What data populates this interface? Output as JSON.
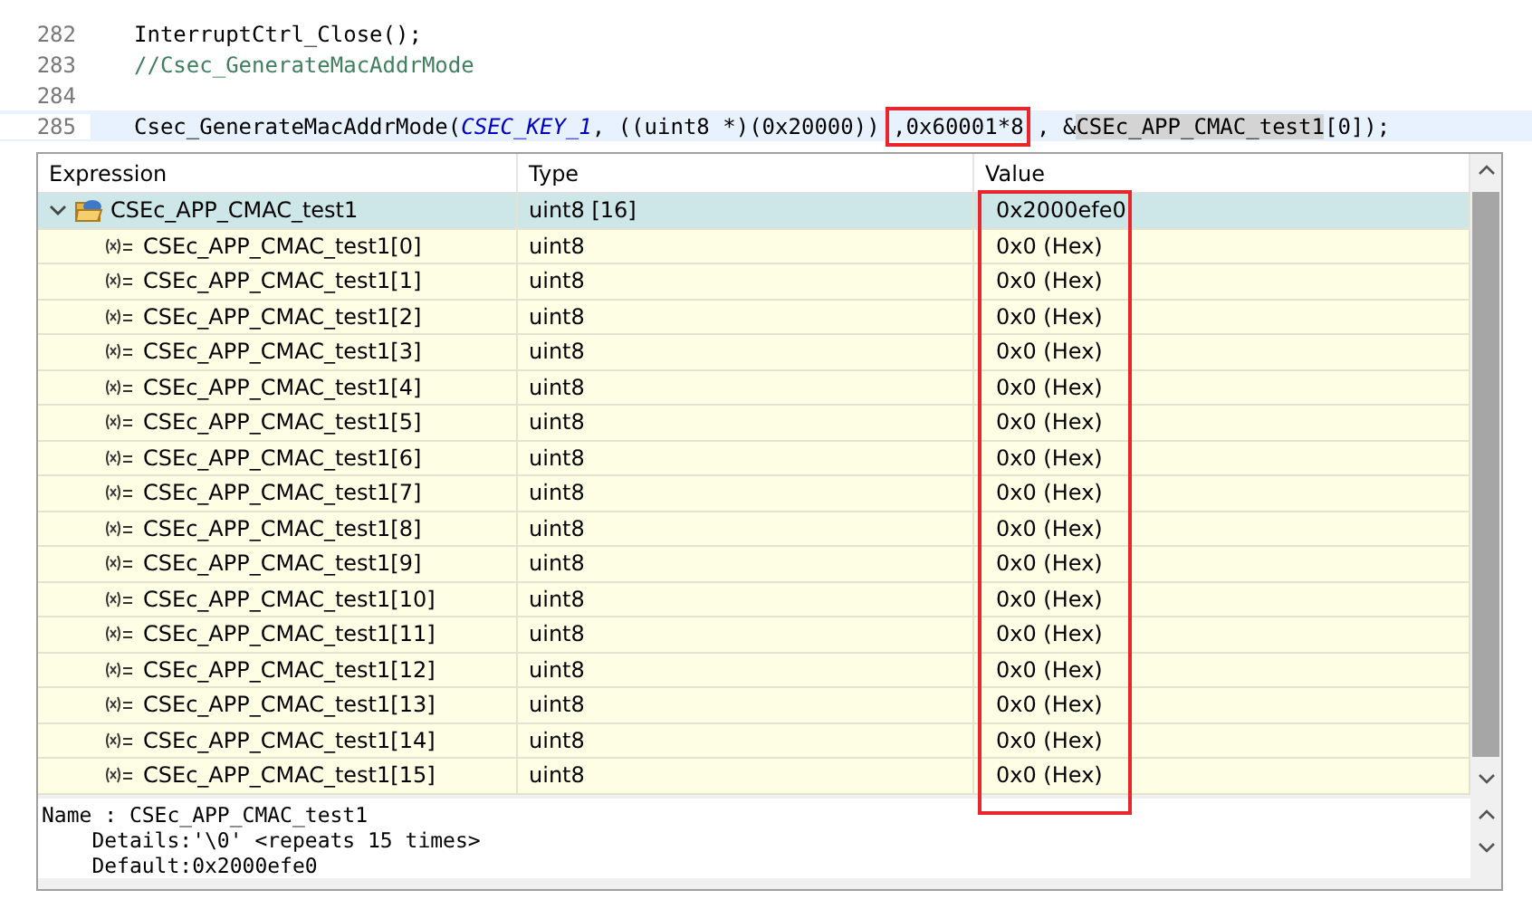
{
  "editor": {
    "lines": [
      {
        "number": "282",
        "current": false,
        "segments": [
          {
            "kind": "plain",
            "text": "InterruptCtrl_Close();"
          }
        ]
      },
      {
        "number": "283",
        "current": false,
        "segments": [
          {
            "kind": "comment",
            "text": "//Csec_GenerateMacAddrMode"
          }
        ]
      },
      {
        "number": "284",
        "current": false
      },
      {
        "number": "285",
        "current": true,
        "segments": [
          {
            "kind": "plain",
            "text": "Csec_GenerateMacAddrMode("
          },
          {
            "kind": "constant",
            "text": "CSEC_KEY_1"
          },
          {
            "kind": "plain",
            "text": ", ((uint8 *)(0x20000)) "
          },
          {
            "kind": "boxed",
            "text": ",0x60001*8"
          },
          {
            "kind": "plain",
            "text": " , &"
          },
          {
            "kind": "occurrence",
            "text": "CSEc_APP_CMAC_test1"
          },
          {
            "kind": "plain",
            "text": "[0]);"
          }
        ]
      }
    ]
  },
  "hover": {
    "columns": [
      "Expression",
      "Type",
      "Value"
    ],
    "value_column_boxed": true,
    "root": {
      "expression": "CSEc_APP_CMAC_test1",
      "type": "uint8 [16]",
      "value": "0x2000efe0",
      "expanded": true,
      "selected": true
    },
    "rows": [
      {
        "expression": "CSEc_APP_CMAC_test1[0]",
        "type": "uint8",
        "value": "0x0 (Hex)"
      },
      {
        "expression": "CSEc_APP_CMAC_test1[1]",
        "type": "uint8",
        "value": "0x0 (Hex)"
      },
      {
        "expression": "CSEc_APP_CMAC_test1[2]",
        "type": "uint8",
        "value": "0x0 (Hex)"
      },
      {
        "expression": "CSEc_APP_CMAC_test1[3]",
        "type": "uint8",
        "value": "0x0 (Hex)"
      },
      {
        "expression": "CSEc_APP_CMAC_test1[4]",
        "type": "uint8",
        "value": "0x0 (Hex)"
      },
      {
        "expression": "CSEc_APP_CMAC_test1[5]",
        "type": "uint8",
        "value": "0x0 (Hex)"
      },
      {
        "expression": "CSEc_APP_CMAC_test1[6]",
        "type": "uint8",
        "value": "0x0 (Hex)"
      },
      {
        "expression": "CSEc_APP_CMAC_test1[7]",
        "type": "uint8",
        "value": "0x0 (Hex)"
      },
      {
        "expression": "CSEc_APP_CMAC_test1[8]",
        "type": "uint8",
        "value": "0x0 (Hex)"
      },
      {
        "expression": "CSEc_APP_CMAC_test1[9]",
        "type": "uint8",
        "value": "0x0 (Hex)"
      },
      {
        "expression": "CSEc_APP_CMAC_test1[10]",
        "type": "uint8",
        "value": "0x0 (Hex)"
      },
      {
        "expression": "CSEc_APP_CMAC_test1[11]",
        "type": "uint8",
        "value": "0x0 (Hex)"
      },
      {
        "expression": "CSEc_APP_CMAC_test1[12]",
        "type": "uint8",
        "value": "0x0 (Hex)"
      },
      {
        "expression": "CSEc_APP_CMAC_test1[13]",
        "type": "uint8",
        "value": "0x0 (Hex)"
      },
      {
        "expression": "CSEc_APP_CMAC_test1[14]",
        "type": "uint8",
        "value": "0x0 (Hex)"
      },
      {
        "expression": "CSEc_APP_CMAC_test1[15]",
        "type": "uint8",
        "value": "0x0 (Hex)"
      }
    ],
    "details": [
      "Name : CSEc_APP_CMAC_test1",
      "    Details:'\\0' <repeats 15 times>",
      "    Default:0x2000efe0"
    ]
  }
}
